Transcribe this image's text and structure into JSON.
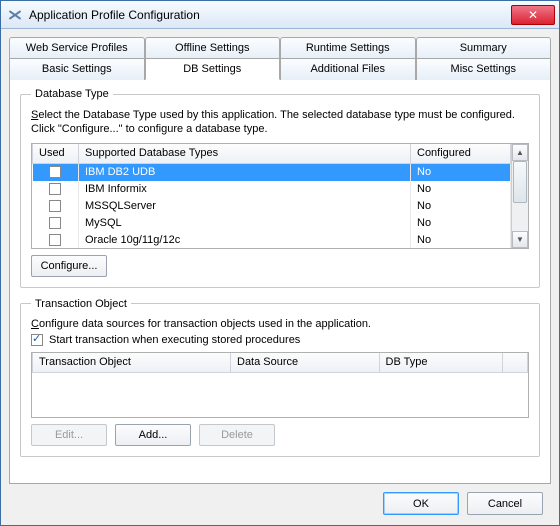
{
  "window": {
    "title": "Application Profile Configuration"
  },
  "tabs_row1": [
    "Web Service Profiles",
    "Offline Settings",
    "Runtime Settings",
    "Summary"
  ],
  "tabs_row2": [
    "Basic Settings",
    "DB Settings",
    "Additional Files",
    "Misc Settings"
  ],
  "active_tab": "DB Settings",
  "db_type": {
    "legend": "Database Type",
    "hint_prefix_u": "S",
    "hint_rest": "elect the Database Type used by this application. The selected database type must be configured. Click \"Configure...\" to configure a database type.",
    "cols": {
      "used": "Used",
      "sdt": "Supported Database Types",
      "cfg": "Configured"
    },
    "rows": [
      {
        "used": false,
        "name": "IBM DB2 UDB",
        "configured": "No",
        "selected": true
      },
      {
        "used": false,
        "name": "IBM Informix",
        "configured": "No",
        "selected": false
      },
      {
        "used": false,
        "name": "MSSQLServer",
        "configured": "No",
        "selected": false
      },
      {
        "used": false,
        "name": "MySQL",
        "configured": "No",
        "selected": false
      },
      {
        "used": false,
        "name": "Oracle 10g/11g/12c",
        "configured": "No",
        "selected": false
      }
    ],
    "configure_btn": "Configure..."
  },
  "trans_obj": {
    "legend": "Transaction Object",
    "hint_prefix_u": "C",
    "hint_rest": "onfigure data sources for transaction objects used in the application.",
    "checkbox_label": "Start transaction when executing stored procedures",
    "checkbox_checked": true,
    "cols": {
      "c1": "Transaction Object",
      "c2": "Data Source",
      "c3": "DB Type",
      "c4": ""
    },
    "buttons": {
      "edit": "Edit...",
      "add": "Add...",
      "delete": "Delete"
    }
  },
  "dialog_buttons": {
    "ok": "OK",
    "cancel": "Cancel"
  }
}
